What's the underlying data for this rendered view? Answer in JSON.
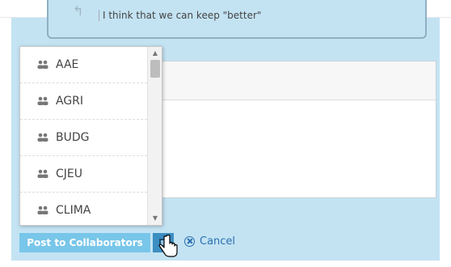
{
  "thread": {
    "quote_text": "I think that we can keep \"better\""
  },
  "dropdown": {
    "items": [
      {
        "label": "AAE",
        "icon": "group-icon"
      },
      {
        "label": "AGRI",
        "icon": "group-icon"
      },
      {
        "label": "BUDG",
        "icon": "group-icon"
      },
      {
        "label": "CJEU",
        "icon": "group-icon"
      },
      {
        "label": "CLIMA",
        "icon": "group-icon"
      }
    ]
  },
  "actions": {
    "post_label": "Post to Collaborators",
    "cancel_label": "Cancel"
  },
  "colors": {
    "panel_bg": "#c3e3f3",
    "post_button": "#78c6e9",
    "dropdown_toggle": "#3d8ec1",
    "link": "#2a6fb0"
  }
}
